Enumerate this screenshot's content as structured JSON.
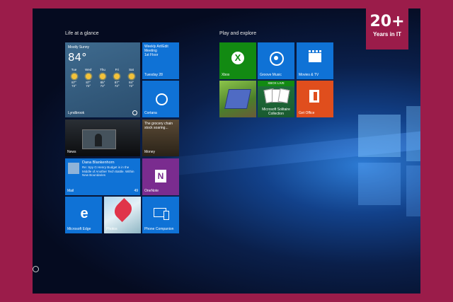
{
  "brand": {
    "number": "20+",
    "tagline": "Years in IT"
  },
  "groups": [
    {
      "title": "Life at a glance"
    },
    {
      "title": "Play and explore"
    }
  ],
  "weather": {
    "condition": "Mostly Sunny",
    "temperature": "84°",
    "days": [
      {
        "name": "Tue",
        "high": "87°",
        "low": "72°"
      },
      {
        "name": "Wed",
        "high": "87°",
        "low": "72°"
      },
      {
        "name": "Thu",
        "high": "85°",
        "low": "72°"
      },
      {
        "name": "Fri",
        "high": "87°",
        "low": "72°"
      },
      {
        "name": "Sat",
        "high": "84°",
        "low": "72°"
      }
    ],
    "location": "Lyndbrook"
  },
  "calendar": {
    "event": "Weekly Art/Edit Meeting",
    "location": "1st Floor",
    "date": "Tuesday 28"
  },
  "cortana": {
    "label": "Cortana"
  },
  "news": {
    "label": "News"
  },
  "money": {
    "headline": "The grocery chain stock soaring...",
    "label": "Money"
  },
  "mail": {
    "from": "Dana Blankenhorn",
    "body": "Re: Spy G Henry Budget is in the Middle of Another Tech Battle. Within New Boundaries",
    "label": "Mail",
    "count": "49"
  },
  "onenote": {
    "label": "OneNote",
    "letter": "N"
  },
  "edge": {
    "label": "Microsoft Edge",
    "letter": "e"
  },
  "photos": {
    "label": "Photos"
  },
  "phone": {
    "label": "Phone Companion"
  },
  "xbox": {
    "label": "Xbox",
    "letter": "X"
  },
  "groove": {
    "label": "Groove Music"
  },
  "movies": {
    "label": "Movies & TV"
  },
  "solitaire": {
    "banner": "XBOX LIVE",
    "label": "Microsoft Solitaire Collection"
  },
  "office": {
    "label": "Get Office"
  }
}
